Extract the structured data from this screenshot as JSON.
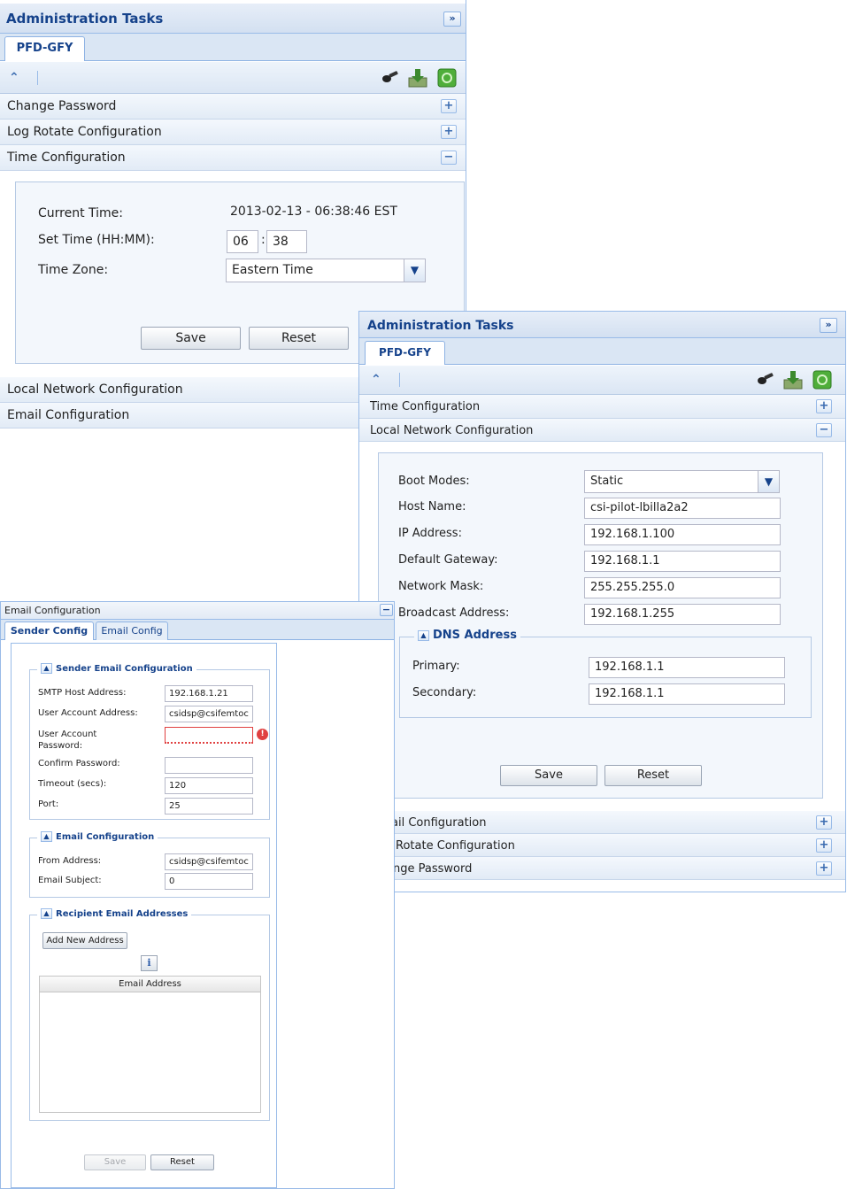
{
  "panel1": {
    "title": "Administration Tasks",
    "collapse_glyph": "»",
    "tab": "PFD-GFY",
    "toolbar": {
      "collapse_glyph": "⌃"
    },
    "accordion_top": [
      {
        "label": "Change Password",
        "glyph": "+"
      },
      {
        "label": "Log Rotate Configuration",
        "glyph": "+"
      },
      {
        "label": "Time Configuration",
        "glyph": "−"
      }
    ],
    "form": {
      "current_time_label": "Current Time:",
      "current_time_value": "2013-02-13 - 06:38:46 EST",
      "set_time_label": "Set Time (HH:MM):",
      "hour": "06",
      "colon": ":",
      "minute": "38",
      "timezone_label": "Time Zone:",
      "timezone_value": "Eastern Time",
      "save": "Save",
      "reset": "Reset"
    },
    "accordion_bottom": [
      {
        "label": "Local Network Configuration"
      },
      {
        "label": "Email Configuration"
      }
    ]
  },
  "panel2": {
    "title": "Administration Tasks",
    "collapse_glyph": "»",
    "tab": "PFD-GFY",
    "toolbar": {
      "collapse_glyph": "⌃"
    },
    "accordion_top": [
      {
        "label": "Time Configuration",
        "glyph": "+"
      },
      {
        "label": "Local Network Configuration",
        "glyph": "−"
      }
    ],
    "form": {
      "boot_modes_label": "Boot Modes:",
      "boot_modes_value": "Static",
      "host_name_label": "Host Name:",
      "host_name_value": "csi-pilot-lbilla2a2",
      "ip_label": "IP Address:",
      "ip_value": "192.168.1.100",
      "gateway_label": "Default Gateway:",
      "gateway_value": "192.168.1.1",
      "mask_label": "Network Mask:",
      "mask_value": "255.255.255.0",
      "broadcast_label": "Broadcast Address:",
      "broadcast_value": "192.168.1.255",
      "dns_legend": "DNS Address",
      "dns_toggle": "▲",
      "primary_label": "Primary:",
      "primary_value": "192.168.1.1",
      "secondary_label": "Secondary:",
      "secondary_value": "192.168.1.1",
      "save": "Save",
      "reset": "Reset"
    },
    "accordion_bottom": [
      {
        "label": "ail Configuration",
        "glyph": "+"
      },
      {
        "label": "Rotate Configuration",
        "glyph": "+"
      },
      {
        "label": "nge Password",
        "glyph": "+"
      }
    ]
  },
  "panel3": {
    "title": "Email Configuration",
    "collapse_glyph": "−",
    "tabs": [
      {
        "label": "Sender Config"
      },
      {
        "label": "Email Config"
      }
    ],
    "sender": {
      "legend": "Sender Email Configuration",
      "toggle": "▲",
      "smtp_label": "SMTP Host Address:",
      "smtp_value": "192.168.1.21",
      "user_label": "User Account Address:",
      "user_value": "csidsp@csifemtoc",
      "password_label": "User Account Password:",
      "password_value": "",
      "confirm_label": "Confirm Password:",
      "confirm_value": "",
      "timeout_label": "Timeout (secs):",
      "timeout_value": "120",
      "port_label": "Port:",
      "port_value": "25",
      "error_glyph": "!"
    },
    "email": {
      "legend": "Email Configuration",
      "toggle": "▲",
      "from_label": "From Address:",
      "from_value": "csidsp@csifemtoc",
      "subject_label": "Email Subject:",
      "subject_value": "0"
    },
    "recipients": {
      "legend": "Recipient Email Addresses",
      "toggle": "▲",
      "add_button": "Add New Address",
      "info_glyph": "i",
      "column_header": "Email Address"
    },
    "save": "Save",
    "reset": "Reset"
  },
  "colors": {
    "header_text": "#15428b",
    "border_blue": "#99bbe8",
    "error_red": "#e04040"
  }
}
